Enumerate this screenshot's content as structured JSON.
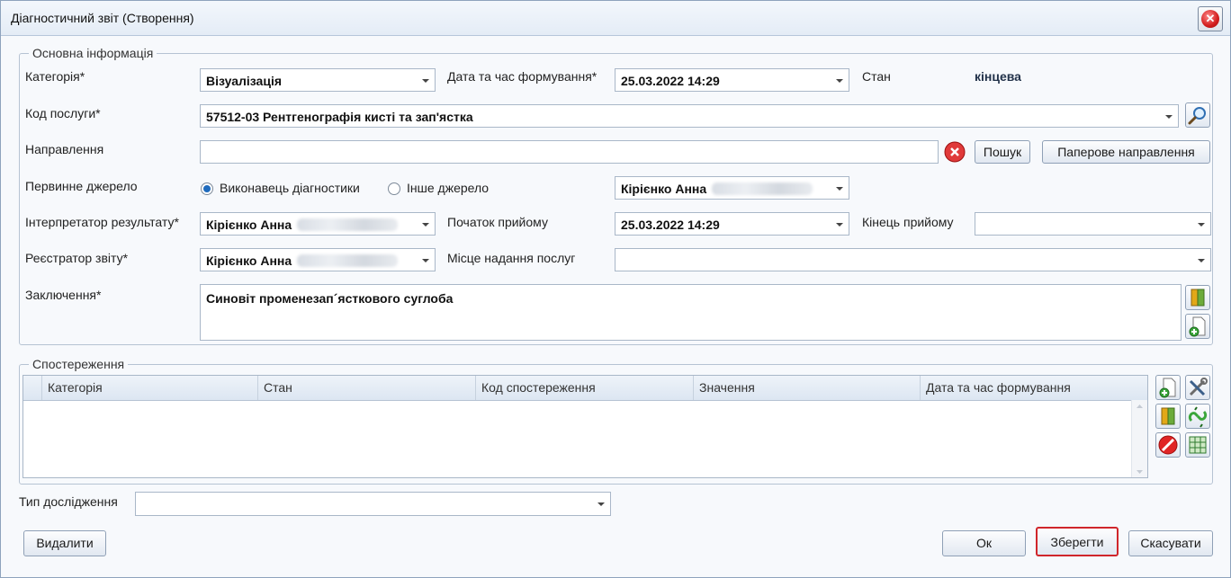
{
  "window": {
    "title": "Діагностичний звіт (Створення)"
  },
  "main_info": {
    "legend": "Основна інформація",
    "category": {
      "label": "Категорія*",
      "value": "Візуалізація"
    },
    "formation_datetime": {
      "label": "Дата та час формування*",
      "value": "25.03.2022 14:29"
    },
    "state": {
      "label": "Стан",
      "value": "кінцева"
    },
    "service_code": {
      "label": "Код послуги*",
      "value": "57512-03 Рентгенографія кисті та зап'ястка"
    },
    "referral": {
      "label": "Направлення",
      "value": "",
      "search_button": "Пошук",
      "paper_button": "Паперове направлення"
    },
    "primary_source": {
      "label": "Первинне джерело",
      "option_performer": "Виконавець діагностики",
      "option_other": "Інше джерело",
      "selected": "Виконавець діагностики",
      "person": "Кірієнко Анна"
    },
    "interpreter": {
      "label": "Інтерпретатор результату*",
      "value": "Кірієнко Анна"
    },
    "reception_start": {
      "label": "Початок прийому",
      "value": "25.03.2022 14:29"
    },
    "reception_end": {
      "label": "Кінець прийому",
      "value": ""
    },
    "registrar": {
      "label": "Реєстратор звіту*",
      "value": "Кірієнко Анна"
    },
    "service_place": {
      "label": "Місце надання послуг",
      "value": ""
    },
    "conclusion": {
      "label": "Заключення*",
      "value": "Синовіт променезап´ясткового суглоба"
    }
  },
  "observations": {
    "legend": "Спостереження",
    "columns": [
      "Категорія",
      "Стан",
      "Код спостереження",
      "Значення",
      "Дата та час формування"
    ],
    "rows": []
  },
  "study_type": {
    "label": "Тип дослідження",
    "value": ""
  },
  "footer": {
    "delete": "Видалити",
    "ok": "Ок",
    "save": "Зберегти",
    "cancel": "Скасувати"
  },
  "colors": {
    "highlight": "#d0262b",
    "accent": "#1f6bbd"
  }
}
